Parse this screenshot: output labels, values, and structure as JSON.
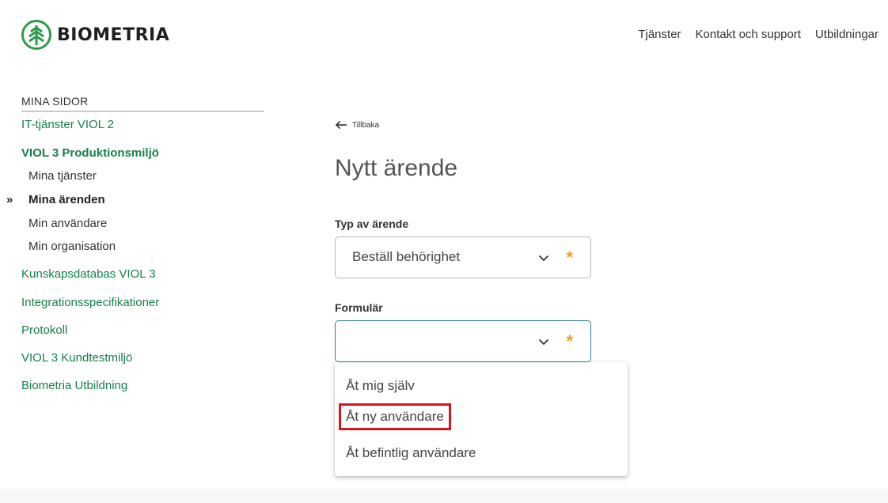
{
  "brand": {
    "name": "BIOMETRIA",
    "color": "#2e9a4a"
  },
  "topnav": [
    "Tjänster",
    "Kontakt och support",
    "Utbildningar"
  ],
  "sidebar": {
    "heading": "MINA SIDOR",
    "items": [
      {
        "label": "IT-tjänster VIOL 2"
      },
      {
        "label": "VIOL 3 Produktionsmiljö"
      },
      {
        "label": "Mina tjänster"
      },
      {
        "label": "Mina ärenden"
      },
      {
        "label": "Min användare"
      },
      {
        "label": "Min organisation"
      },
      {
        "label": "Kunskapsdatabas VIOL 3"
      },
      {
        "label": "Integrationsspecifikationer"
      },
      {
        "label": "Protokoll"
      },
      {
        "label": "VIOL 3 Kundtestmiljö"
      },
      {
        "label": "Biometria Utbildning"
      }
    ],
    "active_marker": "»"
  },
  "main": {
    "back_label": "Tillbaka",
    "title": "Nytt ärende",
    "type_field": {
      "label": "Typ av ärende",
      "value": "Beställ behörighet",
      "required_mark": "*"
    },
    "form_field": {
      "label": "Formulär",
      "value": "",
      "required_mark": "*"
    },
    "dropdown_options": [
      "Åt mig själv",
      "Åt ny användare",
      "Åt befintlig användare"
    ]
  },
  "colors": {
    "link_green": "#16804a",
    "required_orange": "#f0a020",
    "focus_blue": "#2d7ea0",
    "highlight_red": "#d8141c"
  }
}
